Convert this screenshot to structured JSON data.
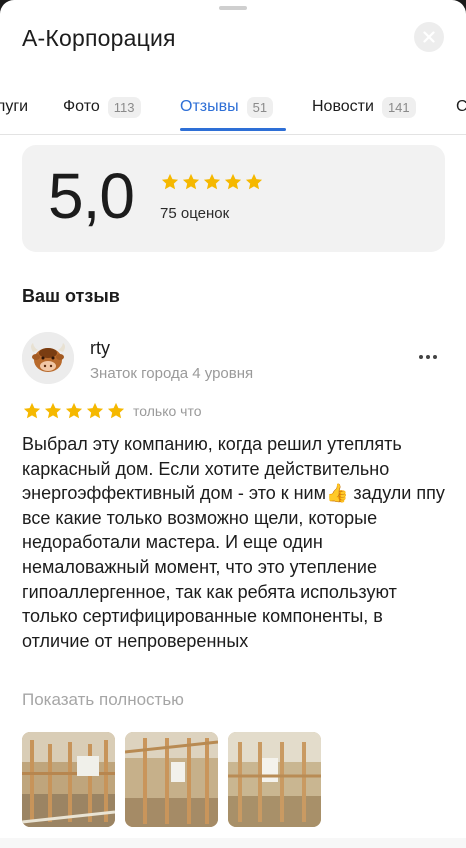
{
  "header": {
    "title": "А-Корпорация",
    "close_icon": "close-icon"
  },
  "tabs": [
    {
      "label": "луги",
      "count": ""
    },
    {
      "label": "Фото",
      "count": "113"
    },
    {
      "label": "Отзывы",
      "count": "51",
      "active": true
    },
    {
      "label": "Новости",
      "count": "141"
    },
    {
      "label": "С",
      "count": ""
    }
  ],
  "rating": {
    "value": "5,0",
    "stars": 5,
    "count_text": "75 оценок"
  },
  "my_review": {
    "section_title": "Ваш отзыв",
    "author": "rty",
    "author_level": "Знаток города 4 уровня",
    "stars": 5,
    "time": "только что",
    "text_parts": [
      "Выбрал эту компанию, когда решил утеплять каркасный дом. Если хотите действительно энергоэффективный дом - это к ним",
      " задули ппу все какие только возможно щели, которые недоработали мастера. И еще один немаловажный момент, что это утепление гипоаллергенное, так как ребята используют только сертифицированные компоненты, в отличие от непроверенных"
    ],
    "emoji": "👍",
    "show_more": "Показать полностью",
    "photos": [
      {
        "name": "photo-1"
      },
      {
        "name": "photo-2"
      },
      {
        "name": "photo-3"
      }
    ]
  },
  "colors": {
    "accent": "#2e6fd6",
    "star": "#f5b800",
    "card_bg": "#f2f2f2"
  }
}
